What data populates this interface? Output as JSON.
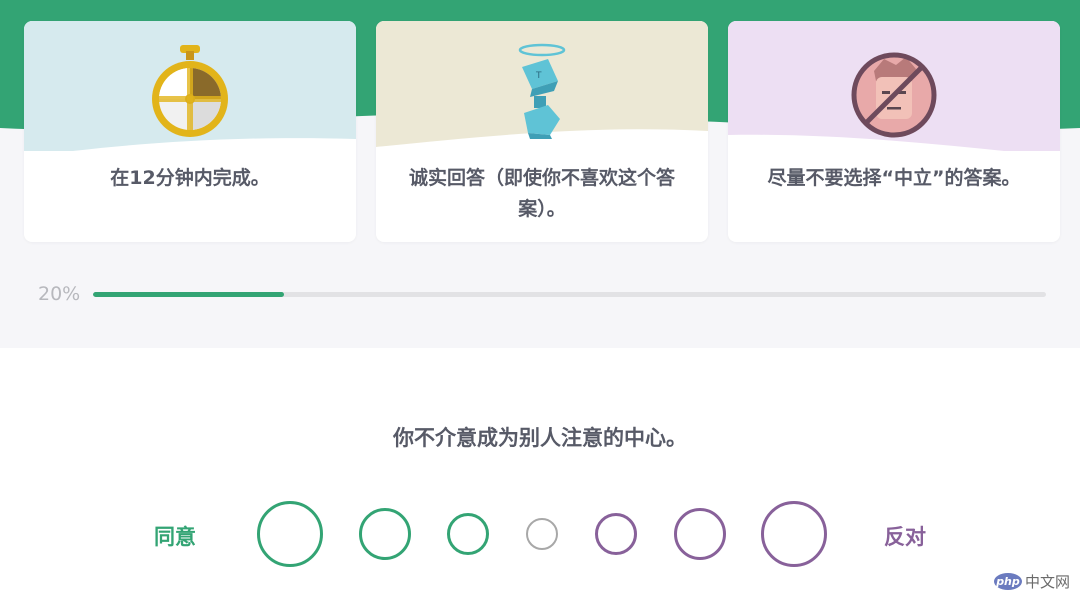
{
  "colors": {
    "brand_green": "#33a474",
    "purple": "#88619a",
    "neutral": "#a8a8a8",
    "text_dark": "#575a67",
    "card1_bg": "#d6eaee",
    "card2_bg": "#ece8d5",
    "card3_bg": "#eddff3"
  },
  "cards": [
    {
      "icon": "stopwatch-icon",
      "text": "在12分钟内完成。"
    },
    {
      "icon": "honest-angel-icon",
      "text": "诚实回答（即使你不喜欢这个答案）。"
    },
    {
      "icon": "no-neutral-face-icon",
      "text": "尽量不要选择“中立”的答案。"
    }
  ],
  "progress": {
    "label": "20%",
    "value": 0.2
  },
  "question": {
    "text": "你不介意成为别人注意的中心。",
    "agree_label": "同意",
    "disagree_label": "反对",
    "options_count": 7
  },
  "watermark": {
    "logo": "php",
    "text": "中文网"
  }
}
